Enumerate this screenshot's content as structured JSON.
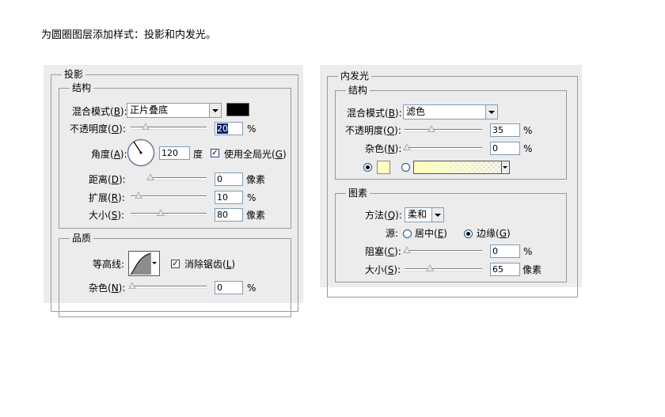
{
  "instruction": "为圆圈图层添加样式：投影和内发光。",
  "drop_shadow": {
    "title": "投影",
    "structure": {
      "title": "结构",
      "blend_mode_label": "混合模式(",
      "blend_mode_key": "B",
      "blend_mode_value": "正片叠底",
      "color": "#000000",
      "opacity_label": "不透明度(",
      "opacity_key": "O",
      "opacity_value": "20",
      "angle_label": "角度(",
      "angle_key": "A",
      "angle_value": "120",
      "angle_unit": "度",
      "global_light_label": "使用全局光(",
      "global_light_key": "G",
      "global_light_checked": true,
      "distance_label": "距离(",
      "distance_key": "D",
      "distance_value": "0",
      "distance_unit": "像素",
      "spread_label": "扩展(",
      "spread_key": "R",
      "spread_value": "10",
      "size_label": "大小(",
      "size_key": "S",
      "size_value": "80",
      "size_unit": "像素",
      "percent": "%"
    },
    "quality": {
      "title": "品质",
      "contour_label": "等高线:",
      "antialias_label": "消除锯齿(",
      "antialias_key": "L",
      "antialias_checked": true,
      "noise_label": "杂色(",
      "noise_key": "N",
      "noise_value": "0",
      "percent": "%"
    }
  },
  "inner_glow": {
    "title": "内发光",
    "structure": {
      "title": "结构",
      "blend_mode_label": "混合模式(",
      "blend_mode_key": "B",
      "blend_mode_value": "滤色",
      "opacity_label": "不透明度(",
      "opacity_key": "O",
      "opacity_value": "35",
      "noise_label": "杂色(",
      "noise_key": "N",
      "noise_value": "0",
      "percent": "%",
      "glow_color": "#ffffbe"
    },
    "elements": {
      "title": "图素",
      "method_label": "方法(",
      "method_key": "Q",
      "method_value": "柔和",
      "source_label": "源:",
      "center_label": "居中(",
      "center_key": "E",
      "edge_label": "边缘(",
      "edge_key": "G",
      "source_selected": "edge",
      "choke_label": "阻塞(",
      "choke_key": "C",
      "choke_value": "0",
      "size_label": "大小(",
      "size_key": "S",
      "size_value": "65",
      "size_unit": "像素",
      "percent": "%"
    }
  }
}
